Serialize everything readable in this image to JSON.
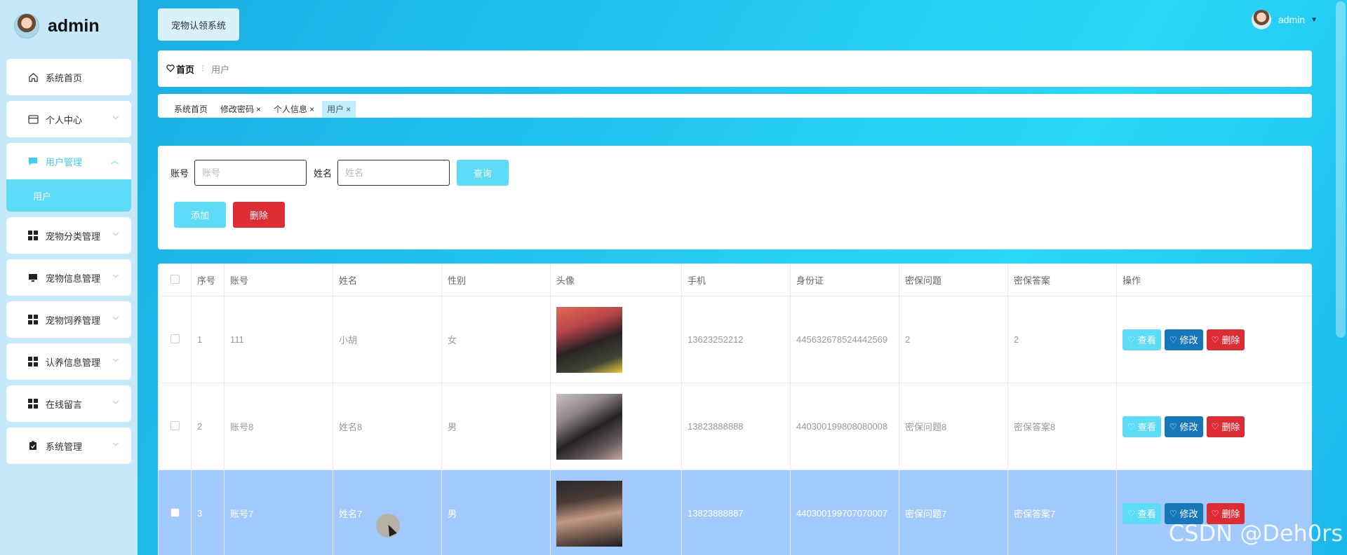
{
  "brand": {
    "name": "admin"
  },
  "sidebar": {
    "items": [
      {
        "label": "系统首页",
        "icon": "home-icon"
      },
      {
        "label": "个人中心",
        "icon": "card-icon"
      },
      {
        "label": "用户管理",
        "icon": "chat-icon",
        "submenu": "用户"
      },
      {
        "label": "宠物分类管理",
        "icon": "grid-icon"
      },
      {
        "label": "宠物信息管理",
        "icon": "monitor-icon"
      },
      {
        "label": "宠物饲养管理",
        "icon": "grid-icon"
      },
      {
        "label": "认养信息管理",
        "icon": "grid-icon"
      },
      {
        "label": "在线留言",
        "icon": "grid-icon"
      },
      {
        "label": "系统管理",
        "icon": "clipboard-icon"
      }
    ]
  },
  "header": {
    "system_name": "宠物认领系统",
    "user": "admin"
  },
  "breadcrumb": {
    "home": "首页",
    "separator": "⁝",
    "current": "用户"
  },
  "tags": [
    {
      "label": "系统首页",
      "close": ""
    },
    {
      "label": "修改密码",
      "close": "×"
    },
    {
      "label": "个人信息",
      "close": "×"
    },
    {
      "label": "用户",
      "close": "×"
    }
  ],
  "search": {
    "account_label": "账号",
    "account_placeholder": "账号",
    "name_label": "姓名",
    "name_placeholder": "姓名",
    "query_label": "查询",
    "add_label": "添加",
    "delete_label": "删除"
  },
  "table": {
    "headers": [
      "序号",
      "账号",
      "姓名",
      "性别",
      "头像",
      "手机",
      "身份证",
      "密保问题",
      "密保答案",
      "操作"
    ],
    "rows": [
      {
        "no": "1",
        "account": "111",
        "name": "小胡",
        "gender": "女",
        "phone": "13623252212",
        "id_card": "445632678524442569",
        "question": "2",
        "answer": "2"
      },
      {
        "no": "2",
        "account": "账号8",
        "name": "姓名8",
        "gender": "男",
        "phone": "13823888888",
        "id_card": "440300199808080008",
        "question": "密保问题8",
        "answer": "密保答案8"
      },
      {
        "no": "3",
        "account": "账号7",
        "name": "姓名7",
        "gender": "男",
        "phone": "13823888887",
        "id_card": "440300199707070007",
        "question": "密保问题7",
        "answer": "密保答案7"
      }
    ],
    "actions": {
      "view": "查看",
      "edit": "修改",
      "delete": "删除"
    }
  },
  "watermark": "CSDN @Deh0rs",
  "colors": {
    "accent": "#5ddcf8",
    "danger": "#dc2d35",
    "edit": "#1677b9",
    "selected_row": "#a2c9fb"
  }
}
